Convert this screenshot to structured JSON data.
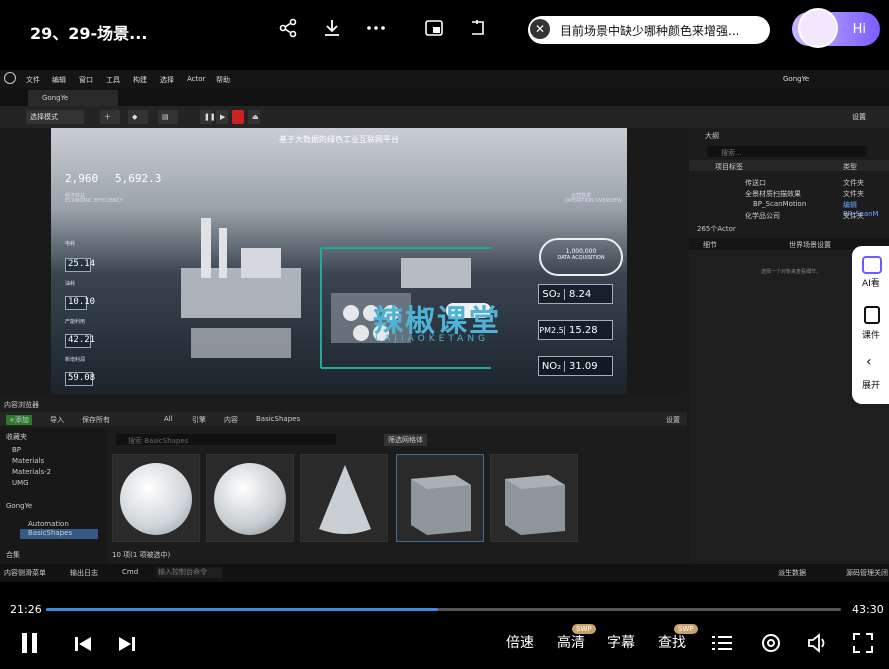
{
  "top": {
    "title": "29、29-场景...",
    "ai_question": "目前场景中缺少哪种颜色来增强...",
    "hi_label": "Hi"
  },
  "editor": {
    "menu": [
      "文件",
      "编辑",
      "窗口",
      "工具",
      "构建",
      "选择",
      "Actor",
      "帮助"
    ],
    "level_tab": "GongYe",
    "window_title": "GongYe",
    "mode_select": "选择模式",
    "settings": "设置"
  },
  "viewport": {
    "title": "基于大数据的绿色工业互联网平台",
    "economic_label": "经济效益",
    "economic_sub": "ECONOMIC EFFICIENCY",
    "econ_a": "2,960",
    "econ_b": "5,692.3",
    "ops_label": "运营数据",
    "ops_sub": "OPERATION OVERVIEW",
    "m1_label": "电耗",
    "m1_value": "25.14",
    "m2_label": "油耗",
    "m2_value": "10.10",
    "m3_label": "产能利用",
    "m3_value": "42.21",
    "m4_label": "新增利润",
    "m4_value": "59.08",
    "badge_value": "1,000,000",
    "badge_label": "DATA ACQUISITION",
    "so2_name": "SO₂",
    "so2_value": "8.24",
    "pm_name": "PM2.5",
    "pm_value": "15.28",
    "no2_name": "NO₂",
    "no2_value": "31.09"
  },
  "watermark": {
    "text": "辣椒课堂",
    "sub": "LAJIAOKETANG"
  },
  "outliner": {
    "title": "大纲",
    "search": "搜索...",
    "col_label": "项目标签",
    "col_type": "类型",
    "rows": [
      {
        "name": "传送口",
        "type": "文件夹"
      },
      {
        "name": "全景材质扫描效果",
        "type": "文件夹"
      },
      {
        "name": "BP_ScanMotion",
        "type": "编辑BP_ScanM"
      },
      {
        "name": "化学品公司",
        "type": "文件夹"
      }
    ],
    "count": "265个Actor"
  },
  "details": {
    "tab1": "细节",
    "tab2": "世界场景设置",
    "empty": "选择一个对象来查看细节。"
  },
  "content_browser": {
    "title": "内容浏览器",
    "add": "+添加",
    "import": "导入",
    "save_all": "保存所有",
    "path": [
      "All",
      "引擎",
      "内容",
      "BasicShapes"
    ],
    "settings": "设置",
    "favorites": "收藏夹",
    "folders": [
      "BP",
      "Materials",
      "Materials-2",
      "UMG"
    ],
    "project": "GongYe",
    "tree": [
      "Automation",
      "BasicShapes"
    ],
    "search_placeholder": "搜索 BasicShapes",
    "filter": "筛选网格体",
    "status": "10 项(1 项被选中)",
    "collections": "合集"
  },
  "statusbar": {
    "drawer": "内容侧滑菜单",
    "output": "输出日志",
    "cmd": "Cmd",
    "cmd_placeholder": "输入控制台命令",
    "derived": "派生数据",
    "source": "源码管理关闭"
  },
  "side_panel": {
    "ai": "AI看",
    "courseware": "课件",
    "expand": "展开"
  },
  "player": {
    "current": "21:26",
    "total": "43:30",
    "progress": 0.493,
    "speed": "倍速",
    "hd": "高清",
    "subtitle": "字幕",
    "search": "查找",
    "swp": "SWP"
  }
}
